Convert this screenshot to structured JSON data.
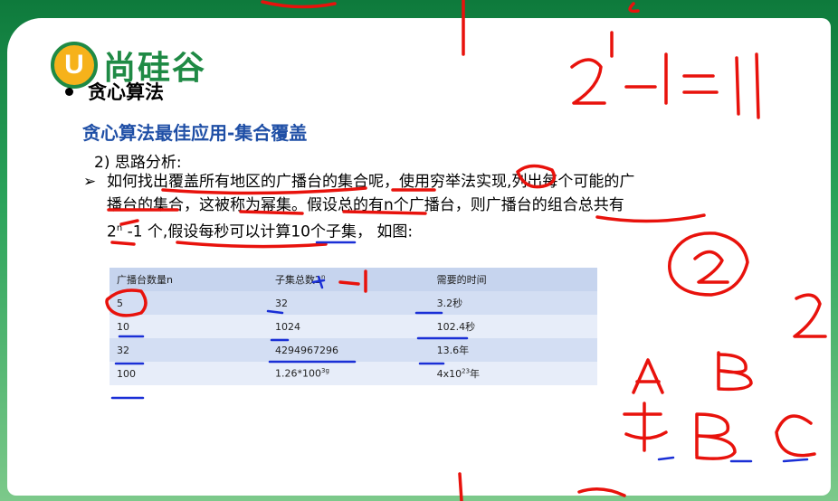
{
  "logo": {
    "mark": "U",
    "text": "尚硅谷"
  },
  "section_title": "贪心算法",
  "subtitle": "贪心算法最佳应用-集合覆盖",
  "point": "2)  思路分析:",
  "paragraph": {
    "arrow": "➢",
    "line1": "如何找出覆盖所有地区的广播台的集合呢，使用穷举法实现,列出每个可能的广",
    "line2": "播台的集合，这被称为幂集。假设总的有n个广播台，则广播台的组合总共有",
    "line3_prefix": "2",
    "line3_sup": "n",
    "line3_rest": " -1 个,假设每秒可以计算10个子集， 如图:"
  },
  "table": {
    "headers": [
      "广播台数量n",
      "子集总数2",
      "需要的时间"
    ],
    "header2_sup": "n",
    "rows": [
      {
        "n": "5",
        "subsets": "32",
        "time": "3.2秒"
      },
      {
        "n": "10",
        "subsets": "1024",
        "time": "102.4秒"
      },
      {
        "n": "32",
        "subsets": "4294967296",
        "time": "13.6年"
      },
      {
        "n": "100",
        "subsets_base": "1.26*100",
        "subsets_sup": "3g",
        "time_base": "4x10",
        "time_sup": "23",
        "time_unit": "年"
      }
    ]
  },
  "handwriting": {
    "formula": "2 - 1 = 1",
    "letters": [
      "A",
      "B",
      "C",
      "2",
      "2"
    ]
  },
  "colors": {
    "ink_red": "#e8120c",
    "ink_blue": "#1a2fd6",
    "brand_green": "#1f8a45",
    "subtitle_blue": "#1f4fa6"
  }
}
